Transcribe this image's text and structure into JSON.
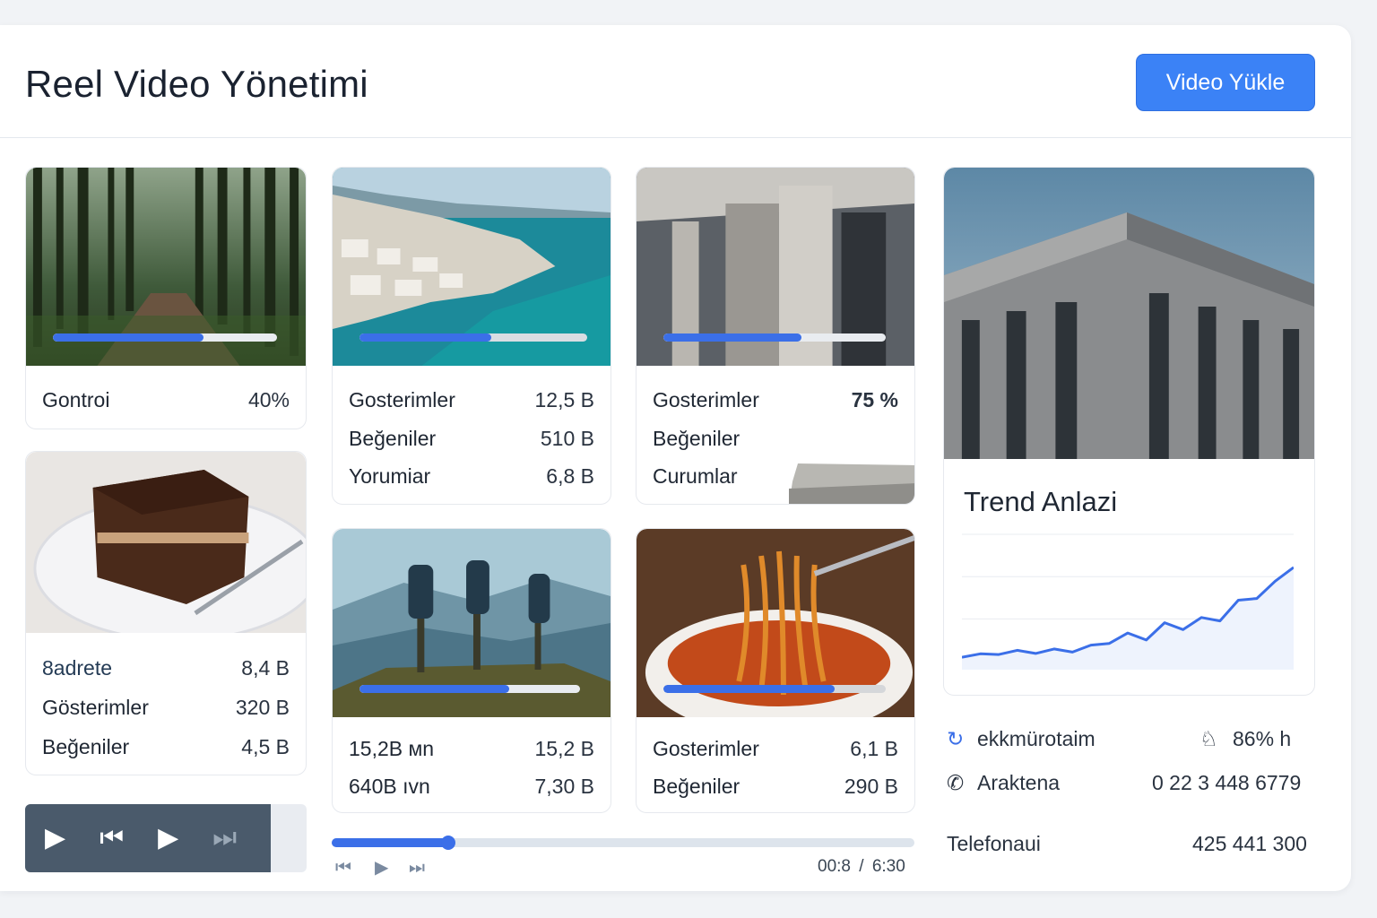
{
  "header": {
    "title": "Reel Video Yönetimi",
    "upload_label": "Video Yükle"
  },
  "accent": "#3b82f6",
  "cards": [
    {
      "image": "forest-path",
      "progress": 0.67,
      "rows": [
        {
          "label": "Gontroi",
          "value": "40%"
        }
      ]
    },
    {
      "image": "coastal-town",
      "progress": 0.58,
      "rows": [
        {
          "label": "Gosterimler",
          "value": "12,5 B"
        },
        {
          "label": "Beğeniler",
          "value": "510 B"
        },
        {
          "label": "Yorumiar",
          "value": "6,8 B"
        }
      ]
    },
    {
      "image": "concrete-building",
      "progress": 0.62,
      "rows": [
        {
          "label": "Gosterimler",
          "value": "75 %"
        },
        {
          "label": "Beğeniler",
          "value": ""
        },
        {
          "label": "Curumlar",
          "value": ""
        }
      ]
    },
    {
      "image": "chocolate-cake",
      "rows": [
        {
          "label": "8adrete",
          "value": "8,4 B"
        },
        {
          "label": "Gösterimler",
          "value": "320 B"
        },
        {
          "label": "Beğeniler",
          "value": "4,5 B"
        }
      ]
    },
    {
      "image": "hikers-mountain",
      "progress": 0.68,
      "rows": [
        {
          "label": "15,2B мn",
          "value": "15,2 B"
        },
        {
          "label": "640B ıvn",
          "value": "7,30 B"
        }
      ]
    },
    {
      "image": "spaghetti-bowl",
      "progress": 0.77,
      "rows": [
        {
          "label": "Gosterimler",
          "value": "6,1 B"
        },
        {
          "label": "Beğeniler",
          "value": "290 B"
        }
      ]
    }
  ],
  "player": {
    "icons": [
      "play-icon",
      "skip-back-icon",
      "play-icon",
      "skip-forward-icon"
    ],
    "progress": 0.2,
    "current_time": "00:8",
    "separator": "/",
    "total_time": "6:30"
  },
  "trend": {
    "image": "modern-building",
    "title": "Trend Anlazi"
  },
  "chart_data": {
    "type": "area",
    "title": "Trend Anlazi",
    "xlabel": "",
    "ylabel": "",
    "grid": true,
    "series": [
      {
        "values": [
          2,
          4,
          3.6,
          6,
          4.2,
          6.8,
          5,
          9,
          10,
          16,
          12,
          22,
          18,
          25,
          23,
          35,
          36,
          46,
          54
        ]
      }
    ],
    "ylim": [
      0,
      70
    ],
    "color": "#3b6fe8"
  },
  "info": [
    {
      "icon": "link-icon",
      "label": "ekkmürotaim",
      "icon2": "bell-icon",
      "value": "86% h"
    },
    {
      "icon": "phone-icon",
      "label": "Araktena",
      "value": "0 22 3 448 6779"
    },
    {
      "label": "Telefonaui",
      "value": "425 441 300"
    }
  ]
}
